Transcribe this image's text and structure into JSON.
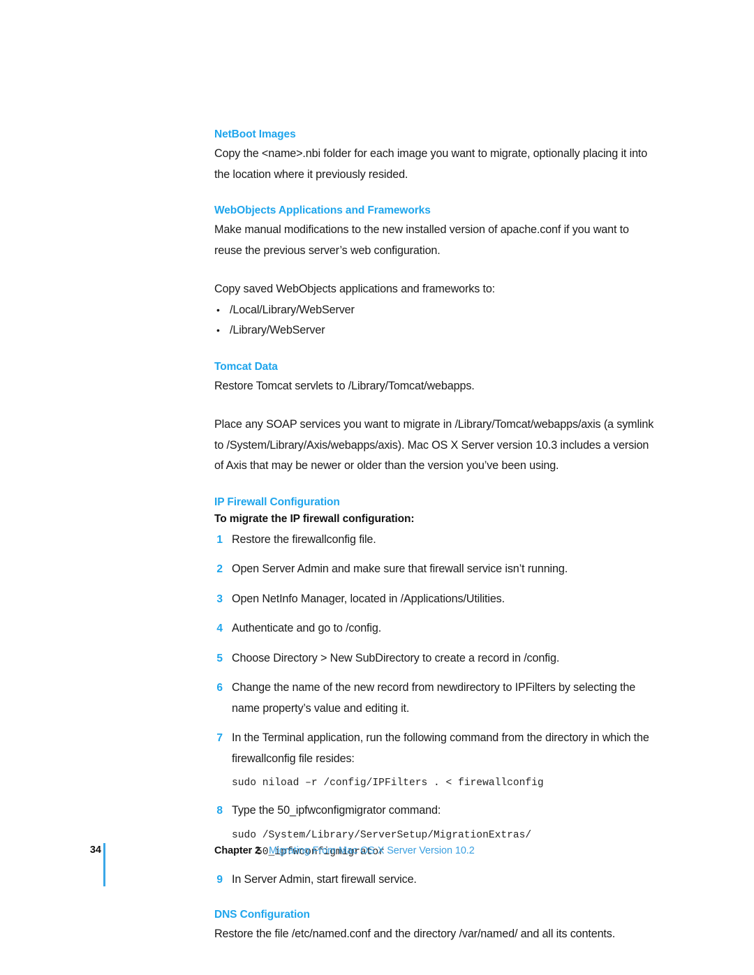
{
  "document": {
    "sections": [
      {
        "id": "netboot-images",
        "heading": "NetBoot Images",
        "paragraph": "Copy the <name>.nbi folder for each image you want to migrate, optionally placing it into the location where it previously resided."
      },
      {
        "id": "webobjects",
        "heading": "WebObjects Applications and Frameworks",
        "paragraph": "Make manual modifications to the new installed version of apache.conf if you want to reuse the previous server’s web configuration.",
        "paragraph2": "Copy saved WebObjects applications and frameworks to:",
        "bullets": [
          "/Local/Library/WebServer",
          "/Library/WebServer"
        ]
      },
      {
        "id": "tomcat-data",
        "heading": "Tomcat Data",
        "paragraph": "Restore Tomcat servlets to /Library/Tomcat/webapps.",
        "paragraph2": "Place any SOAP services you want to migrate in /Library/Tomcat/webapps/axis (a symlink to /System/Library/Axis/webapps/axis). Mac OS X Server version 10.3 includes a version of Axis that may be newer or older than the version you’ve been using."
      },
      {
        "id": "ip-firewall-configuration",
        "heading": "IP Firewall Configuration",
        "subheading": "To migrate the IP firewall configuration:"
      },
      {
        "id": "dns-configuration",
        "heading": "DNS Configuration",
        "paragraph": "Restore the file /etc/named.conf and the directory /var/named/ and all its contents."
      }
    ],
    "steps": [
      {
        "num": "1",
        "text": "Restore the firewallconfig file."
      },
      {
        "num": "2",
        "text": "Open Server Admin and make sure that firewall service isn’t running."
      },
      {
        "num": "3",
        "text": "Open NetInfo Manager, located in /Applications/Utilities."
      },
      {
        "num": "4",
        "text": "Authenticate and go to /config."
      },
      {
        "num": "5",
        "text": "Choose Directory > New SubDirectory to create a record in /config."
      },
      {
        "num": "6",
        "text": "Change the name of the new record from newdirectory to IPFilters by selecting the name property’s value and editing it."
      },
      {
        "num": "7",
        "text": "In the Terminal application, run the following command from the directory in which the firewallconfig file resides:"
      },
      {
        "num": "8",
        "text": "Type the 50_ipfwconfigmigrator command:"
      },
      {
        "num": "9",
        "text": "In Server Admin, start firewall service."
      }
    ],
    "code_blocks": [
      {
        "id": "niload-command",
        "text": "sudo niload –r /config/IPFilters . < firewallconfig"
      },
      {
        "id": "ipfwconfigmigrator-command",
        "text": "sudo /System/Library/ServerSetup/MigrationExtras/\n    50_ipfwconfigmigrator"
      }
    ],
    "footer": {
      "page_number": "34",
      "chapter_label": "Chapter 2",
      "chapter_title": "Migrating From Mac OS X Server Version 10.2"
    },
    "colors": {
      "heading_blue": "#1fa5ec",
      "footer_rule_blue": "#3aa7e8",
      "footer_title_blue": "#3a9fe0",
      "body_text": "#1a1a1a",
      "page_background": "#ffffff"
    }
  }
}
